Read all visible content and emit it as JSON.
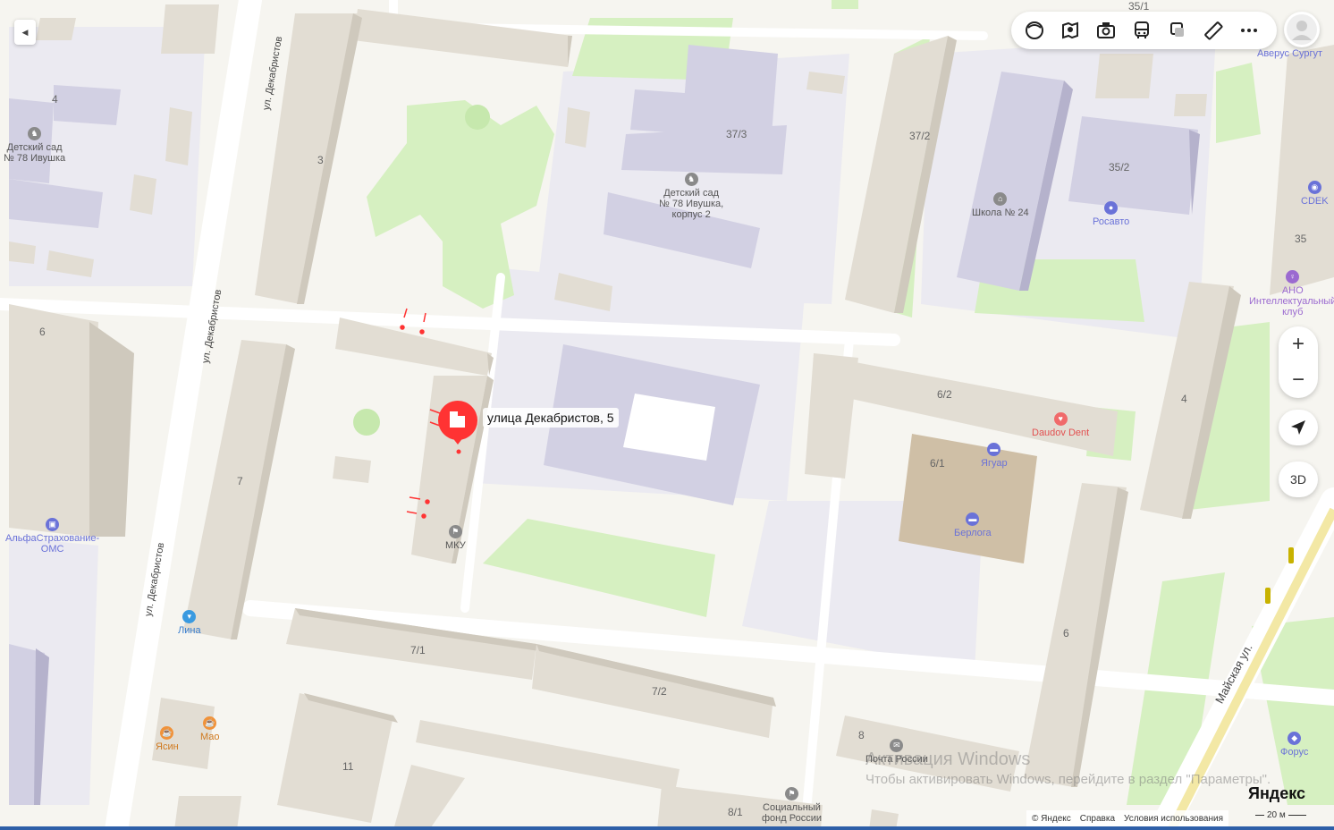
{
  "map": {
    "selected_address": "улица Декабристов, 5",
    "streets": {
      "dekabristov_top": "ул. Декабристов",
      "dekabristov_mid": "ул. Декабристов",
      "dekabristov_bottom": "ул. Декабристов",
      "mayskaya": "Майская ул."
    },
    "house_numbers": {
      "n4": "4",
      "n3": "3",
      "n6": "6",
      "n7": "7",
      "n373": "37/3",
      "n372": "37/2",
      "n352": "35/2",
      "n351": "35/1",
      "n35": "35",
      "n4b": "4",
      "n62": "6/2",
      "n61": "6/1",
      "n71": "7/1",
      "n72": "7/2",
      "n6b": "6",
      "n8": "8",
      "n81": "8/1",
      "n11": "11"
    },
    "pois": {
      "kindergarten1": "Детский сад\n№ 78 Ивушка",
      "kindergarten2": "Детский сад\n№ 78 Ивушка,\nкорпус 2",
      "school": "Школа № 24",
      "rosavto": "Росавто",
      "averus": "Аверус Сургут",
      "cdek": "CDEK",
      "ano": "АНО\nИнтеллектуальный\nклуб",
      "daudov": "Daudov Dent",
      "yaguar": "Ягуар",
      "berloga": "Берлога",
      "mku": "МКУ",
      "alfa": "АльфаСтрахование-\nОМС",
      "lina": "Лина",
      "yasin": "Ясин",
      "mao": "Мао",
      "pochta": "Почта России",
      "socfond": "Социальный\nфонд России",
      "forus": "Форус"
    }
  },
  "controls": {
    "zoom_in": "+",
    "zoom_out": "−",
    "view_3d": "3D",
    "collapse": "◀"
  },
  "overlay": {
    "watermark_title": "Активация Windows",
    "watermark_text": "Чтобы активировать Windows, перейдите в раздел \"Параметры\".",
    "logo": "Яндекс",
    "footer_copyright": "© Яндекс",
    "footer_help": "Справка",
    "footer_terms": "Условия использования",
    "scale": "20 м"
  },
  "colors": {
    "building": "#e2ddd3",
    "building_side": "#cfc9bd",
    "school_building": "#d2d0e3",
    "school_side": "#b5b2cc",
    "green": "#d6f0c1",
    "road": "#ffffff",
    "accent_red": "#f33",
    "poi_blue": "#6a72d8",
    "poi_purple": "#9b6ad0"
  }
}
